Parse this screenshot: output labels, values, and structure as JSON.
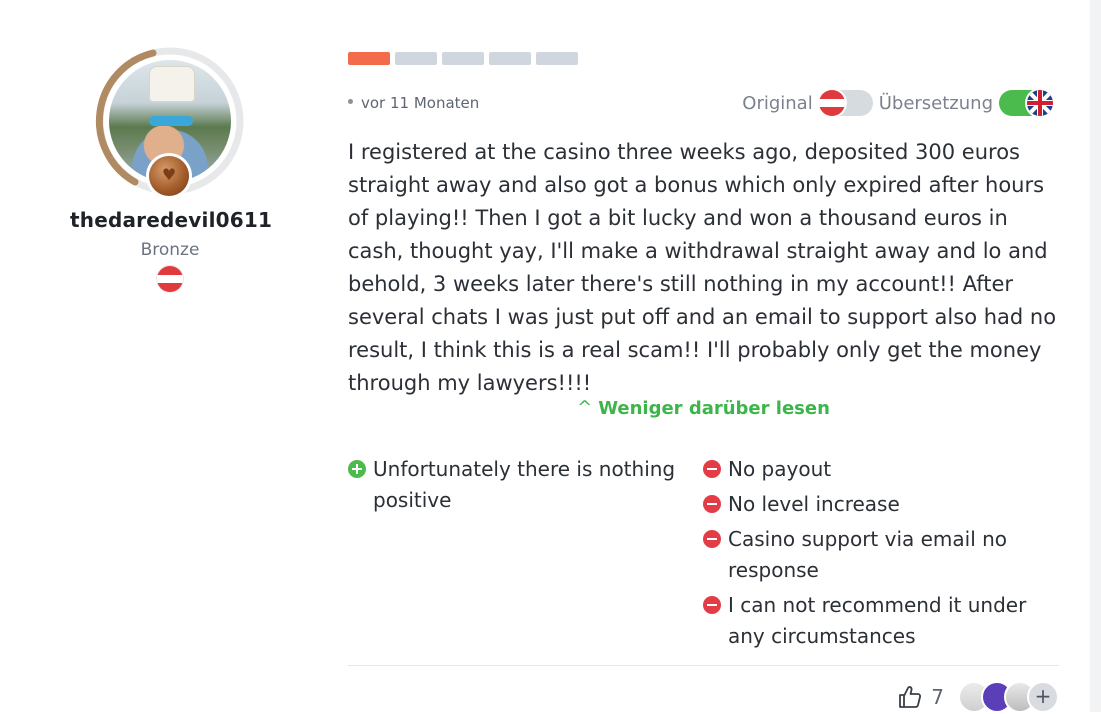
{
  "profile": {
    "username": "thedaredevil0611",
    "rank": "Bronze",
    "country_flag_colors": [
      "#e03a3e",
      "#ffffff",
      "#e03a3e"
    ],
    "badge_icon": "heart-medal-icon"
  },
  "review": {
    "rating": {
      "filled": 1,
      "total": 5,
      "filled_color": "#f26b4a",
      "empty_color": "#cfd6dd"
    },
    "date": "vor 11 Monaten",
    "translation": {
      "original_label": "Original",
      "original_on": false,
      "translation_label": "Übersetzung",
      "translation_on": true
    },
    "text": "I registered at the casino three weeks ago, deposited 300 euros straight away and also got a bonus which only expired after hours of playing!! Then I got a bit lucky and won a thousand euros in cash, thought yay, I'll make a withdrawal straight away and lo and behold, 3 weeks later there's still nothing in my account!! After several chats I was just put off and an email to support also had no result, I think this is a real scam!! I'll probably only get the money through my lawyers!!!!",
    "read_less_label": "Weniger darüber lesen",
    "pros": [
      "Unfortunately there is nothing positive"
    ],
    "cons": [
      "No payout",
      "No level increase",
      "Casino support via email no response",
      "I can not recommend it under any circumstances"
    ],
    "likes": "7",
    "liker_more_label": "+"
  },
  "colors": {
    "accent_green": "#3db54a",
    "negative_red": "#e23d47",
    "positive_green": "#4cbb4d"
  }
}
